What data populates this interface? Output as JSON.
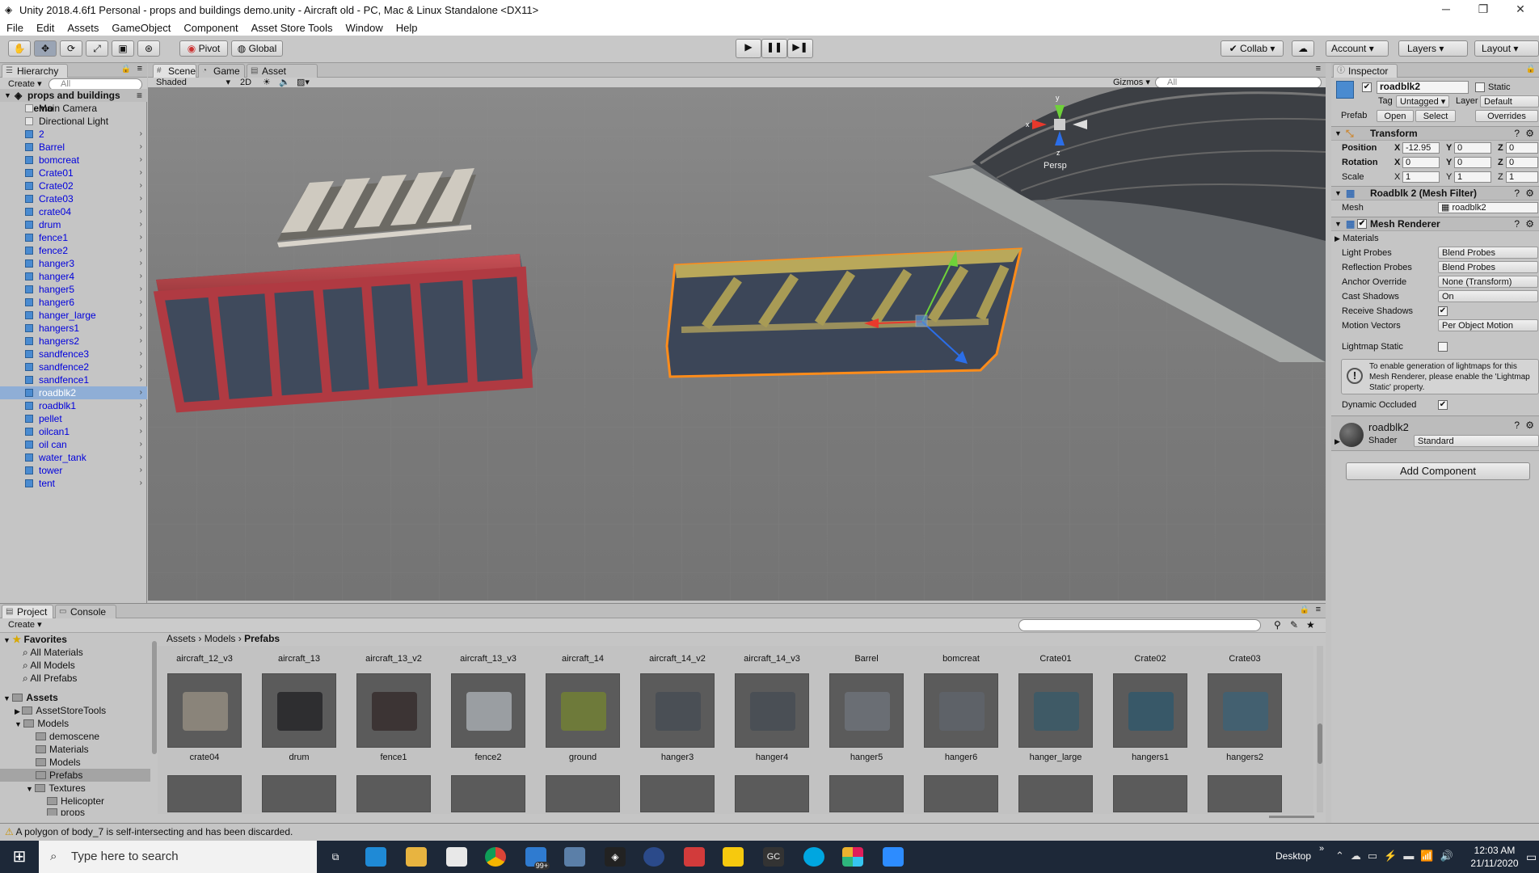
{
  "window": {
    "title": "Unity 2018.4.6f1 Personal - props and buildings demo.unity - Aircraft old - PC, Mac & Linux Standalone <DX11>"
  },
  "menu": [
    "File",
    "Edit",
    "Assets",
    "GameObject",
    "Component",
    "Asset Store Tools",
    "Window",
    "Help"
  ],
  "toolbar": {
    "pivot": "Pivot",
    "global": "Global",
    "collab": "Collab ▾",
    "account": "Account",
    "layers": "Layers",
    "layout": "Layout"
  },
  "hierarchy": {
    "tab": "Hierarchy",
    "create": "Create ▾",
    "search_placeholder": "All",
    "scene_name": "props and buildings demo",
    "items": [
      "Main Camera",
      "Directional Light",
      "2",
      "Barrel",
      "bomcreat",
      "Crate01",
      "Crate02",
      "Crate03",
      "crate04",
      "drum",
      "fence1",
      "fence2",
      "hanger3",
      "hanger4",
      "hanger5",
      "hanger6",
      "hanger_large",
      "hangers1",
      "hangers2",
      "sandfence3",
      "sandfence2",
      "sandfence1",
      "roadblk2",
      "roadblk1",
      "pellet",
      "oilcan1",
      "oil can",
      "water_tank",
      "tower",
      "tent"
    ],
    "selected": "roadblk2"
  },
  "scene": {
    "tabs": [
      "Scene",
      "Game",
      "Asset Store"
    ],
    "shading": "Shaded",
    "mode2d": "2D",
    "gizmos": "Gizmos ▾",
    "search_placeholder": "All",
    "persp": "Persp",
    "axis_x": "x",
    "axis_y": "y",
    "axis_z": "z"
  },
  "inspector": {
    "tab": "Inspector",
    "object_name": "roadblk2",
    "static": "Static",
    "tag_label": "Tag",
    "tag": "Untagged",
    "layer_label": "Layer",
    "layer": "Default",
    "prefab_label": "Prefab",
    "prefab_open": "Open",
    "prefab_select": "Select",
    "prefab_overrides": "Overrides",
    "transform": {
      "title": "Transform",
      "position_label": "Position",
      "rotation_label": "Rotation",
      "scale_label": "Scale",
      "position": [
        "-12.95",
        "0",
        "0"
      ],
      "rotation": [
        "0",
        "0",
        "0"
      ],
      "scale": [
        "1",
        "1",
        "1"
      ],
      "x": "X",
      "y": "Y",
      "z": "Z"
    },
    "mesh_filter": {
      "title": "Roadblk 2 (Mesh Filter)",
      "mesh_label": "Mesh",
      "mesh": "roadblk2"
    },
    "mesh_renderer": {
      "title": "Mesh Renderer",
      "materials": "Materials",
      "rows": [
        [
          "Light Probes",
          "Blend Probes"
        ],
        [
          "Reflection Probes",
          "Blend Probes"
        ],
        [
          "Anchor Override",
          "None (Transform)"
        ],
        [
          "Cast Shadows",
          "On"
        ]
      ],
      "receive_shadows": "Receive Shadows",
      "motion_vectors": "Motion Vectors",
      "motion_vectors_value": "Per Object Motion",
      "lightmap_static": "Lightmap Static",
      "info": "To enable generation of lightmaps for this Mesh Renderer, please enable the 'Lightmap Static' property.",
      "dynamic_occluded": "Dynamic Occluded"
    },
    "material": {
      "name": "roadblk2",
      "shader_label": "Shader",
      "shader": "Standard"
    },
    "add_component": "Add Component"
  },
  "project": {
    "tabs": [
      "Project",
      "Console"
    ],
    "create": "Create ▾",
    "breadcrumb": [
      "Assets",
      "Models",
      "Prefabs"
    ],
    "favorites": {
      "title": "Favorites",
      "items": [
        "All Materials",
        "All Models",
        "All Prefabs"
      ]
    },
    "assets": {
      "title": "Assets",
      "items": [
        "AssetStoreTools",
        "Models",
        "demoscene",
        "Materials",
        "Models",
        "Prefabs",
        "Textures",
        "Helicopter",
        "props"
      ]
    },
    "top_labels": [
      "aircraft_12_v3",
      "aircraft_13",
      "aircraft_13_v2",
      "aircraft_13_v3",
      "aircraft_14",
      "aircraft_14_v2",
      "aircraft_14_v3",
      "Barrel",
      "bomcreat",
      "Crate01",
      "Crate02",
      "Crate03"
    ],
    "row_labels": [
      "crate04",
      "drum",
      "fence1",
      "fence2",
      "ground",
      "hanger3",
      "hanger4",
      "hanger5",
      "hanger6",
      "hanger_large",
      "hangers1",
      "hangers2"
    ]
  },
  "status": {
    "message": "A polygon of body_7 is self-intersecting and has been discarded."
  },
  "taskbar": {
    "search": "Type here to search",
    "desktop": "Desktop",
    "time": "12:03 AM",
    "date": "21/11/2020",
    "badge": "99+"
  }
}
